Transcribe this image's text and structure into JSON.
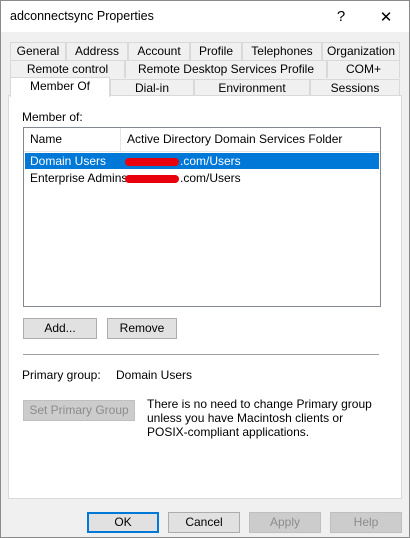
{
  "window": {
    "title": "adconnectsync Properties",
    "help_glyph": "?",
    "close_glyph": "✕"
  },
  "tabs": {
    "row1": [
      "General",
      "Address",
      "Account",
      "Profile",
      "Telephones",
      "Organization"
    ],
    "row2": [
      "Remote control",
      "Remote Desktop Services Profile",
      "COM+"
    ],
    "row3": [
      "Member Of",
      "Dial-in",
      "Environment",
      "Sessions"
    ],
    "active": "Member Of"
  },
  "member_of": {
    "label": "Member of:",
    "columns": [
      "Name",
      "Active Directory Domain Services Folder"
    ],
    "rows": [
      {
        "name": "Domain Users",
        "folder": ".com/Users",
        "selected": true
      },
      {
        "name": "Enterprise Admins",
        "folder": ".com/Users",
        "selected": false
      }
    ],
    "add_label": "Add...",
    "remove_label": "Remove"
  },
  "primary_group": {
    "label": "Primary group:",
    "value": "Domain Users",
    "set_button_label": "Set Primary Group",
    "note": "There is no need to change Primary group unless you have Macintosh clients or POSIX-compliant applications."
  },
  "footer": {
    "ok_label": "OK",
    "cancel_label": "Cancel",
    "apply_label": "Apply",
    "help_label": "Help"
  },
  "colors": {
    "selection": "#0078d7",
    "redaction": "#e8000c"
  }
}
